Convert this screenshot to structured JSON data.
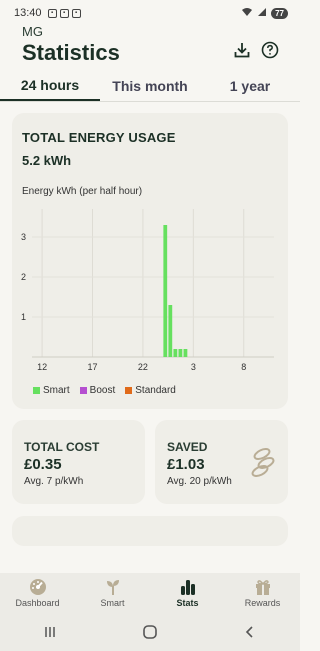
{
  "status": {
    "time": "13:40",
    "battery": "77"
  },
  "header": {
    "user": "MG",
    "title": "Statistics"
  },
  "tabs": [
    {
      "label": "24 hours"
    },
    {
      "label": "This month"
    },
    {
      "label": "1 year"
    }
  ],
  "energy": {
    "title": "TOTAL ENERGY USAGE",
    "value": "5.2 kWh",
    "subtitle": "Energy kWh (per half hour)",
    "legend": [
      {
        "label": "Smart",
        "color": "#66e05f"
      },
      {
        "label": "Boost",
        "color": "#b54fd0"
      },
      {
        "label": "Standard",
        "color": "#e06a1a"
      }
    ]
  },
  "cost": {
    "title": "TOTAL COST",
    "value": "£0.35",
    "sub": "Avg. 7 p/kWh"
  },
  "saved": {
    "title": "SAVED",
    "value": "£1.03",
    "sub": "Avg. 20 p/kWh"
  },
  "nav": {
    "items": [
      {
        "label": "Dashboard"
      },
      {
        "label": "Smart"
      },
      {
        "label": "Stats"
      },
      {
        "label": "Rewards"
      }
    ]
  },
  "chart_data": {
    "type": "bar",
    "series": [
      {
        "name": "Smart",
        "color": "#66e05f",
        "x": [
          24.0,
          24.5,
          25.0,
          25.5,
          26.0
        ],
        "values": [
          3.3,
          1.3,
          0.2,
          0.2,
          0.2
        ]
      },
      {
        "name": "Boost",
        "color": "#b54fd0",
        "x": [],
        "values": []
      },
      {
        "name": "Standard",
        "color": "#e06a1a",
        "x": [],
        "values": []
      }
    ],
    "x_ticks": [
      "12",
      "17",
      "22",
      "3",
      "8"
    ],
    "x_tick_hours": [
      12,
      17,
      22,
      27,
      32
    ],
    "xlim": [
      11,
      35
    ],
    "y_ticks": [
      "1",
      "2",
      "3"
    ],
    "y_tick_values": [
      1,
      2,
      3
    ],
    "ylim": [
      0,
      3.7
    ],
    "ylabel": "Energy kWh (per half hour)",
    "grid": true,
    "legend_position": "bottom-left"
  }
}
